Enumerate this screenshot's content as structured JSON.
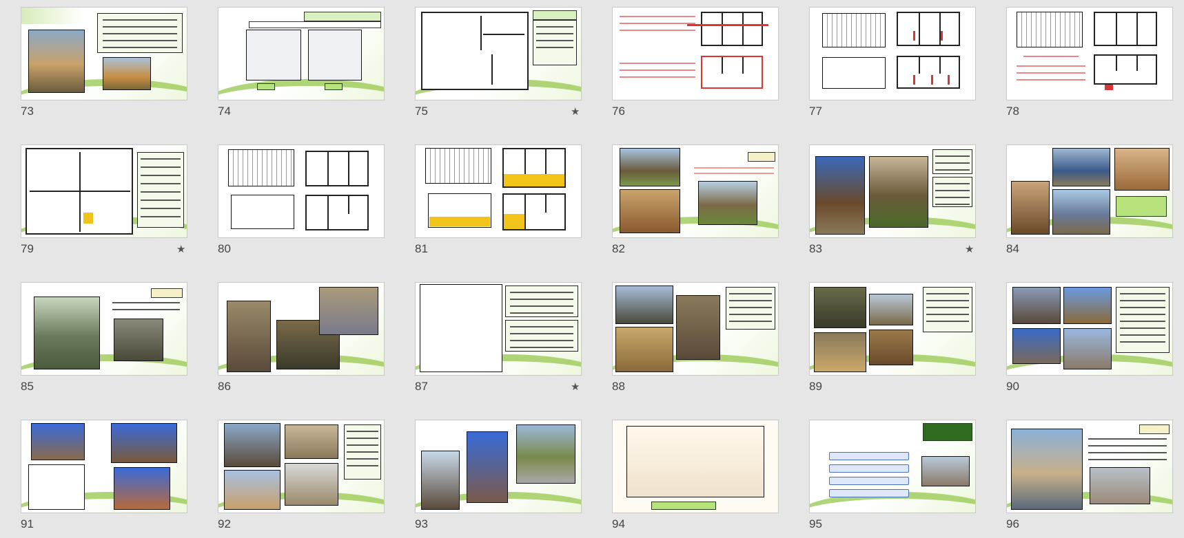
{
  "slides": [
    {
      "number": "73",
      "star": false
    },
    {
      "number": "74",
      "star": false
    },
    {
      "number": "75",
      "star": true
    },
    {
      "number": "76",
      "star": false
    },
    {
      "number": "77",
      "star": false
    },
    {
      "number": "78",
      "star": false
    },
    {
      "number": "79",
      "star": true
    },
    {
      "number": "80",
      "star": false
    },
    {
      "number": "81",
      "star": false
    },
    {
      "number": "82",
      "star": false
    },
    {
      "number": "83",
      "star": true
    },
    {
      "number": "84",
      "star": false
    },
    {
      "number": "85",
      "star": false
    },
    {
      "number": "86",
      "star": false
    },
    {
      "number": "87",
      "star": true
    },
    {
      "number": "88",
      "star": false
    },
    {
      "number": "89",
      "star": false
    },
    {
      "number": "90",
      "star": false
    },
    {
      "number": "91",
      "star": false
    },
    {
      "number": "92",
      "star": false
    },
    {
      "number": "93",
      "star": false
    },
    {
      "number": "94",
      "star": false
    },
    {
      "number": "95",
      "star": false
    },
    {
      "number": "96",
      "star": false
    }
  ],
  "star_glyph": "★",
  "colors": {
    "accent_green": "#7fb63a",
    "plan_red": "#d33",
    "plan_yellow": "#f2c318"
  }
}
